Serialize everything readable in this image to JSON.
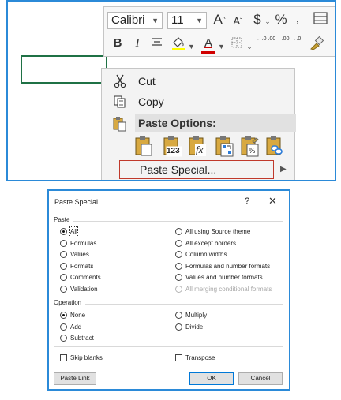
{
  "mini_toolbar": {
    "font_name": "Calibri",
    "font_size": "11",
    "increase_font": "A",
    "decrease_font": "A",
    "currency": "$",
    "percent": "%",
    "comma": ",",
    "bold": "B",
    "italic": "I",
    "font_color_letter": "A",
    "increase_decimal": "←.0 .00",
    "decrease_decimal": ".00 →.0",
    "accent_color": "#d00000"
  },
  "context_menu": {
    "cut": "Cut",
    "copy": "Copy",
    "paste_options_title": "Paste Options:",
    "paste_icons": [
      "paste-icon",
      "paste-values-icon",
      "paste-formulas-icon",
      "paste-transpose-icon",
      "paste-formatting-icon",
      "paste-link-icon"
    ],
    "paste_values_number": "123",
    "paste_formulas_glyph": "fx",
    "paste_special": "Paste Special..."
  },
  "dialog": {
    "title": "Paste Special",
    "help": "?",
    "close": "✕",
    "paste_section": "Paste",
    "paste_options_left": [
      "All",
      "Formulas",
      "Values",
      "Formats",
      "Comments",
      "Validation"
    ],
    "paste_options_right": [
      "All using Source theme",
      "All except borders",
      "Column widths",
      "Formulas and number formats",
      "Values and number formats",
      "All merging conditional formats"
    ],
    "selected_paste": "All",
    "operation_section": "Operation",
    "operations_left": [
      "None",
      "Add",
      "Subtract"
    ],
    "operations_right": [
      "Multiply",
      "Divide"
    ],
    "selected_operation": "None",
    "skip_blanks": "Skip blanks",
    "transpose": "Transpose",
    "paste_link": "Paste Link",
    "ok": "OK",
    "cancel": "Cancel"
  },
  "colors": {
    "frame_border": "#2b8ad8",
    "cell_border": "#1f7145",
    "highlight_border": "#c0392b"
  }
}
